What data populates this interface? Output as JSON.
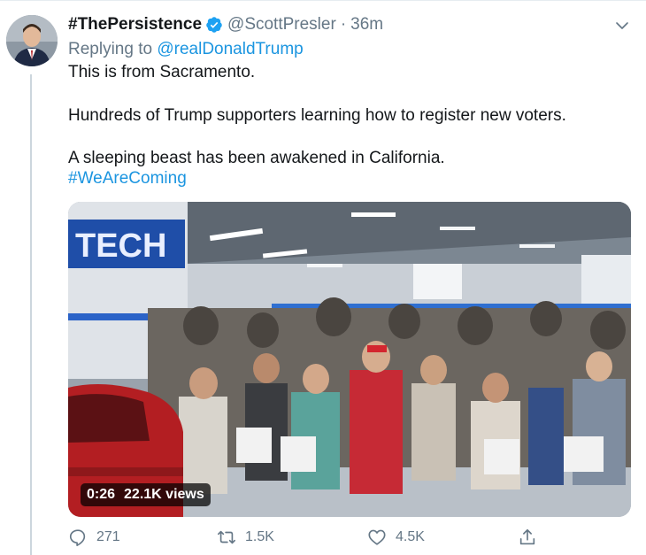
{
  "tweet": {
    "display_name": "#ThePersistence",
    "handle": "@ScottPresler",
    "separator": "·",
    "time": "36m",
    "replying_prefix": "Replying to ",
    "replying_to": "@realDonaldTrump",
    "lines": [
      "This is from Sacramento.",
      "Hundreds of Trump supporters learning how to register new voters.",
      "A sleeping beast has been awakened in California."
    ],
    "hashtag": "#WeAreComing"
  },
  "video": {
    "duration": "0:26",
    "views": "22.1K views"
  },
  "actions": {
    "reply_count": "271",
    "retweet_count": "1.5K",
    "like_count": "4.5K"
  },
  "colors": {
    "link": "#1b95e0",
    "secondary_text": "#657786",
    "verified": "#1da1f2"
  },
  "icons": {
    "verified": "verified-badge-icon",
    "menu": "chevron-down-icon",
    "reply": "reply-icon",
    "retweet": "retweet-icon",
    "like": "heart-icon",
    "share": "share-icon"
  }
}
